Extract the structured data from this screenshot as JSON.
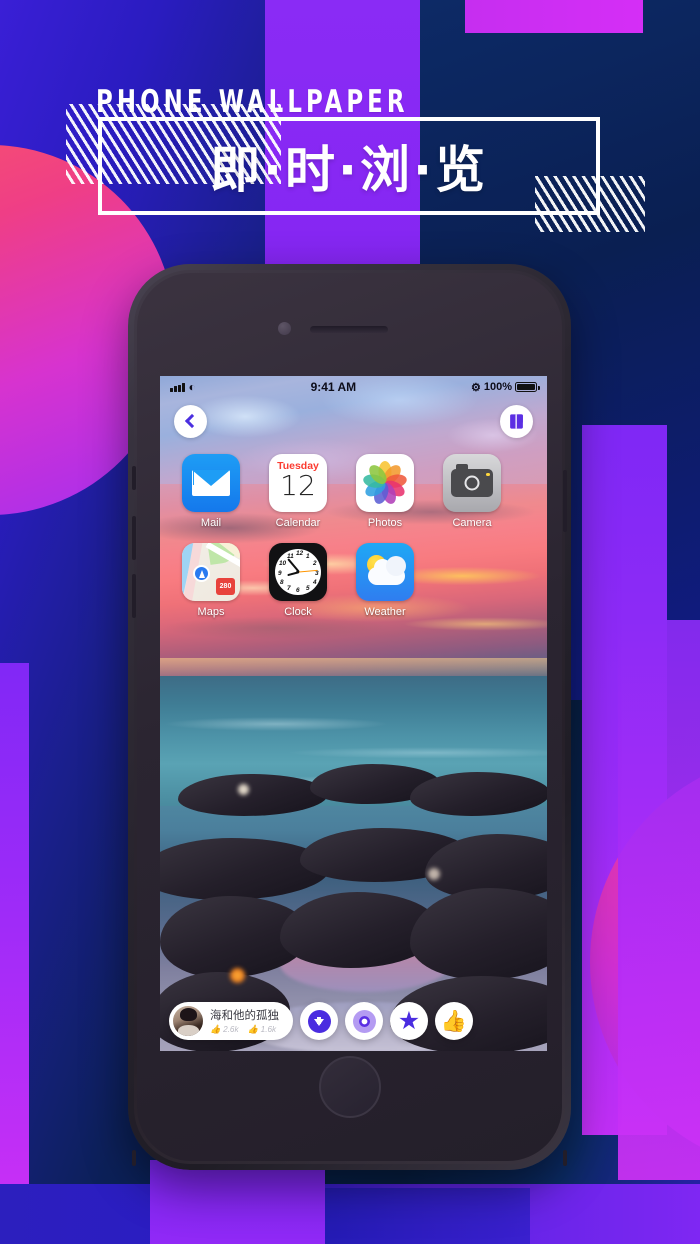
{
  "promo": {
    "kicker": "PHONE WALLPAPER",
    "headline": "即·时·浏·览"
  },
  "colors": {
    "accent_purple": "#7f27f3",
    "accent_magenta": "#d52ef6",
    "accent_pink": "#f03d8d",
    "deep_blue": "#1b1f7e",
    "navy": "#0a1f52",
    "button_purple": "#4a2ce0"
  },
  "phone": {
    "status_bar": {
      "signal": "signal-bars-icon",
      "wifi": "wifi-icon",
      "time": "9:41 AM",
      "bluetooth": "bluetooth-icon",
      "battery_percent": "100%",
      "battery": "battery-full-icon"
    },
    "nav": {
      "back": "back-chevron-icon",
      "bookmark": "bookmark-icon"
    },
    "apps": [
      [
        {
          "name": "Mail",
          "icon": "mail-icon"
        },
        {
          "name": "Calendar",
          "icon": "calendar-icon",
          "weekday": "Tuesday",
          "day": "12"
        },
        {
          "name": "Photos",
          "icon": "photos-icon"
        },
        {
          "name": "Camera",
          "icon": "camera-icon"
        }
      ],
      [
        {
          "name": "Maps",
          "icon": "maps-icon",
          "route": "280"
        },
        {
          "name": "Clock",
          "icon": "clock-icon"
        },
        {
          "name": "Weather",
          "icon": "weather-icon"
        }
      ]
    ],
    "bottom_bar": {
      "author": {
        "name": "海和他的孤独",
        "likes": "2.6k",
        "thumbs": "1.6k"
      },
      "actions": [
        {
          "name": "download",
          "icon": "download-icon"
        },
        {
          "name": "preview",
          "icon": "ring-target-icon"
        },
        {
          "name": "favorite",
          "icon": "star-icon"
        },
        {
          "name": "like",
          "icon": "thumbs-up-icon"
        }
      ]
    }
  }
}
